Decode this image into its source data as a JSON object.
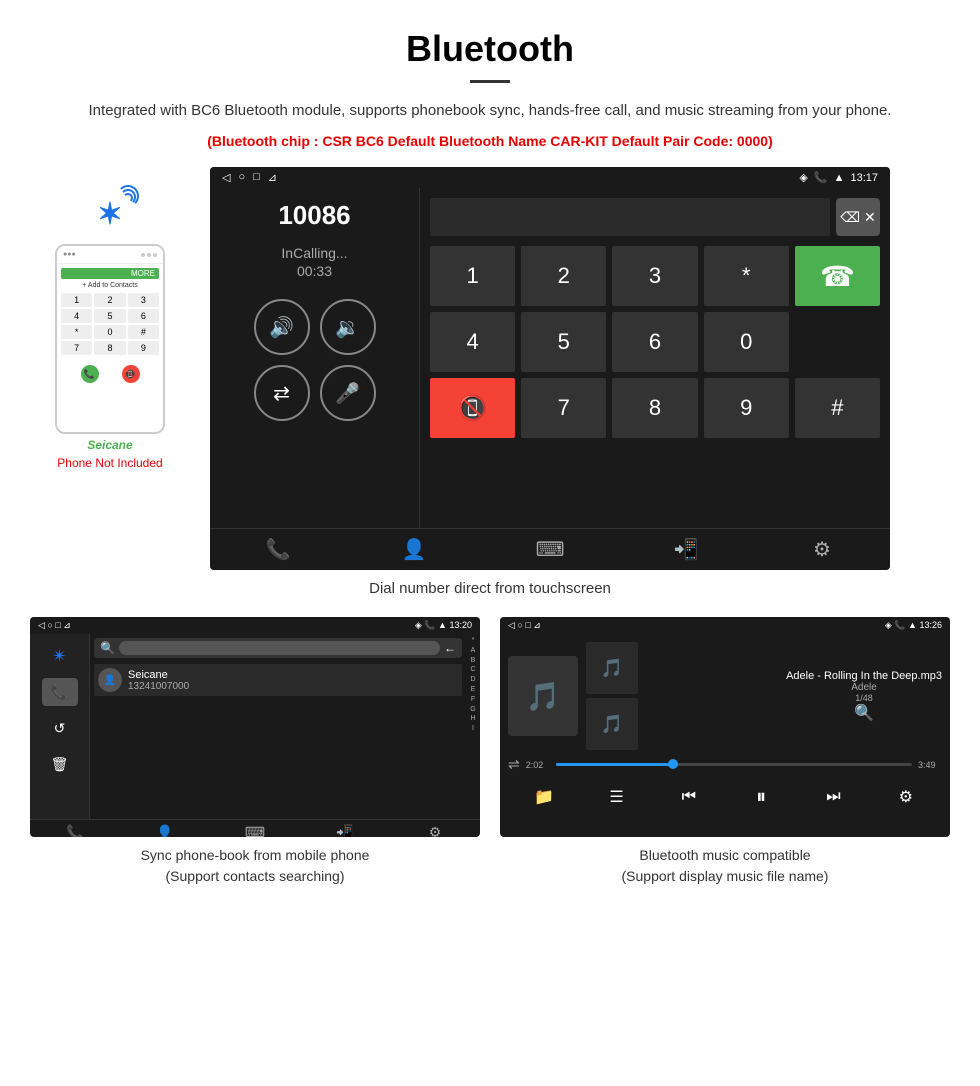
{
  "header": {
    "title": "Bluetooth",
    "description": "Integrated with BC6 Bluetooth module, supports phonebook sync, hands-free call, and music streaming from your phone.",
    "specs": "(Bluetooth chip : CSR BC6    Default Bluetooth Name CAR-KIT    Default Pair Code: 0000)"
  },
  "phone_mock": {
    "dial_keys": [
      "1",
      "2",
      "3",
      "4",
      "5",
      "6",
      "*",
      "0",
      "#"
    ],
    "seicane_label": "Seicane",
    "phone_not_included": "Phone Not Included"
  },
  "car_unit": {
    "status_bar": {
      "left": [
        "◁",
        "○",
        "□",
        "⊿"
      ],
      "right": "13:17"
    },
    "phone_number": "10086",
    "incalling": "InCalling...",
    "timer": "00:33",
    "keypad": {
      "keys": [
        "1",
        "2",
        "3",
        "*",
        "4",
        "5",
        "6",
        "0",
        "7",
        "8",
        "9",
        "#"
      ]
    },
    "call_green_icon": "☎",
    "call_red_icon": "☎"
  },
  "demo_label": "Dial number direct from touchscreen",
  "bottom_left": {
    "label_line1": "Sync phone-book from mobile phone",
    "label_line2": "(Support contacts searching)",
    "status_time": "13:20",
    "contact_name": "Seicane",
    "contact_number": "13241007000",
    "alpha_letters": [
      "*",
      "A",
      "B",
      "C",
      "D",
      "E",
      "F",
      "G",
      "H",
      "I"
    ]
  },
  "bottom_right": {
    "label_line1": "Bluetooth music compatible",
    "label_line2": "(Support display music file name)",
    "status_time": "13:26",
    "song_title": "Adele - Rolling In the Deep.mp3",
    "artist": "Adele",
    "track": "1/48",
    "time_current": "2:02",
    "time_total": "3:49",
    "progress_percent": 33
  }
}
